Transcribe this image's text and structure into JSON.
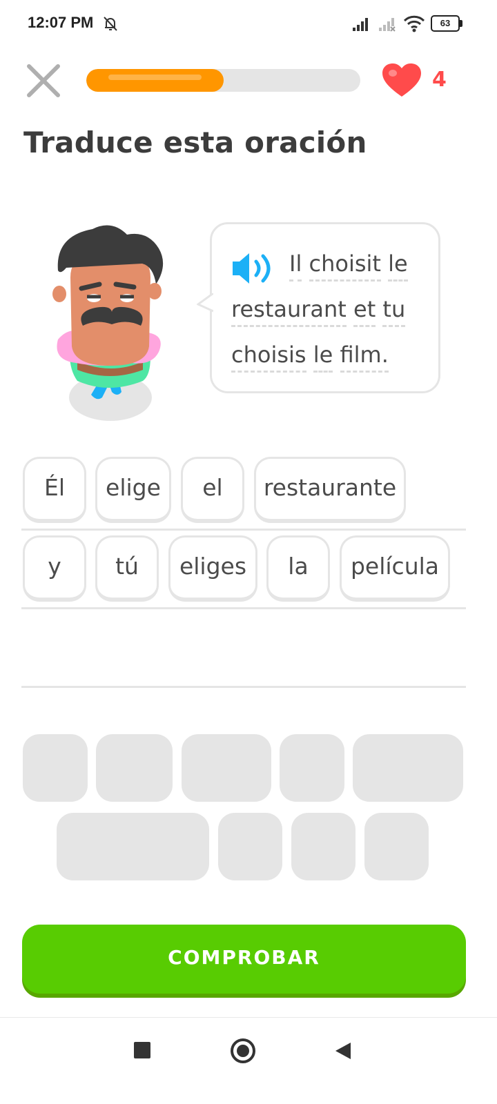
{
  "status_bar": {
    "time": "12:07 PM",
    "battery": "63",
    "icons": [
      "bell-off-icon",
      "signal-icon",
      "signal-no-sim-icon",
      "wifi-icon",
      "battery-icon"
    ]
  },
  "header": {
    "close_icon": "close-icon",
    "progress_fraction": 0.5,
    "hearts": "4"
  },
  "title": "Traduce esta oración",
  "prompt": {
    "line1": [
      "Il",
      "choisit",
      "le"
    ],
    "line2": [
      "restaurant",
      "et",
      "tu"
    ],
    "line3": [
      "choisis",
      "le",
      "film."
    ]
  },
  "answer_tiles": [
    "Él",
    "elige",
    "el",
    "restaurante",
    "y",
    "tú",
    "eliges",
    "la",
    "película"
  ],
  "check_button": "COMPROBAR",
  "colors": {
    "progress": "#ff9600",
    "heart": "#ff4b4b",
    "check_button": "#58cc02",
    "speaker": "#1cb0f6"
  }
}
